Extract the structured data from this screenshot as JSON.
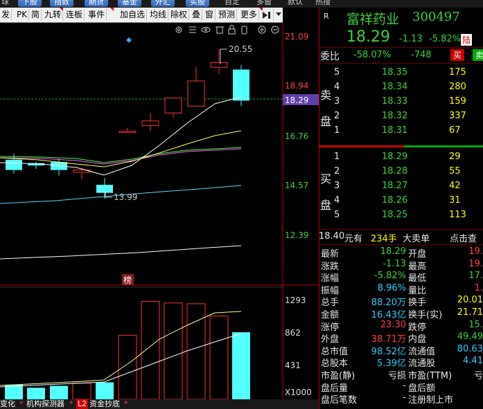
{
  "top_strip": {
    "tabs": [
      "下股",
      "指数",
      "期货",
      "基金",
      "外汇",
      "买股"
    ],
    "plain": [
      "球",
      "自定",
      "多窗",
      "默认",
      "热搜"
    ]
  },
  "toolbar": {
    "buttons": [
      "发",
      "PK",
      "简",
      "九转",
      "连板",
      "事件",
      "加自选",
      "均线",
      "除权",
      "叠",
      "窗",
      "预测",
      "更多"
    ],
    "more_icon": "play-bar-icon",
    "dropdown_icon": "chevron-down-icon"
  },
  "chart_icons": [
    "gear-icon",
    "tune-icon",
    "eye-icon",
    "trash-icon",
    "lock-icon",
    "hand-icon",
    "zoom-in-icon",
    "zoom-out-icon"
  ],
  "price_axis": {
    "ticks": [
      "21.09",
      "18.94",
      "18.29",
      "16.76",
      "14.57",
      "12.39"
    ],
    "current": "18.29",
    "high_label": "20.55",
    "low_label": "13.99",
    "badge": "榜"
  },
  "volume_axis": {
    "ticks": [
      "1293",
      "862",
      "431",
      "X1000"
    ]
  },
  "chart_data": {
    "type": "candlestick",
    "candles": [
      {
        "open": 15.7,
        "high": 15.95,
        "low": 15.1,
        "close": 15.25
      },
      {
        "open": 15.55,
        "high": 15.6,
        "low": 15.3,
        "close": 15.45
      },
      {
        "open": 15.6,
        "high": 15.75,
        "low": 15.0,
        "close": 15.25
      },
      {
        "open": 15.15,
        "high": 15.35,
        "low": 14.85,
        "close": 15.25
      },
      {
        "open": 14.6,
        "high": 14.9,
        "low": 13.99,
        "close": 14.25
      },
      {
        "open": 16.95,
        "high": 17.1,
        "low": 16.95,
        "close": 16.95
      },
      {
        "open": 17.2,
        "high": 17.75,
        "low": 16.95,
        "close": 17.4
      },
      {
        "open": 17.75,
        "high": 18.45,
        "low": 17.55,
        "close": 18.4
      },
      {
        "open": 18.05,
        "high": 19.75,
        "low": 18.05,
        "close": 19.15
      },
      {
        "open": 19.75,
        "high": 20.55,
        "low": 19.45,
        "close": 19.95
      },
      {
        "open": 19.65,
        "high": 19.85,
        "low": 18.05,
        "close": 18.29
      }
    ],
    "volumes": [
      190,
      150,
      175,
      210,
      220,
      830,
      1270,
      1250,
      1240,
      1080,
      870
    ],
    "ylim_price": [
      12.39,
      21.09
    ],
    "ylim_volume": [
      0,
      1293
    ]
  },
  "stock": {
    "badge": "R",
    "name": "富祥药业",
    "code": "300497",
    "price": "18.29",
    "change": "-1.13",
    "pct": "-5.82%",
    "market_tag": "陆"
  },
  "weibi": {
    "label": "委比",
    "pct": "-58.07%",
    "diff": "-748",
    "buy_btn": "买",
    "sell_btn": "卖"
  },
  "order_book": {
    "sell_label": [
      "卖",
      "盘"
    ],
    "buy_label": [
      "买",
      "盘"
    ],
    "sells": [
      {
        "level": "5",
        "price": "18.35",
        "vol": "175"
      },
      {
        "level": "4",
        "price": "18.34",
        "vol": "280"
      },
      {
        "level": "3",
        "price": "18.33",
        "vol": "159"
      },
      {
        "level": "2",
        "price": "18.32",
        "vol": "337"
      },
      {
        "level": "1",
        "price": "18.31",
        "vol": "67"
      }
    ],
    "buys": [
      {
        "level": "1",
        "price": "18.29",
        "vol": "29"
      },
      {
        "level": "2",
        "price": "18.28",
        "vol": "55"
      },
      {
        "level": "3",
        "price": "18.27",
        "vol": "42"
      },
      {
        "level": "4",
        "price": "18.26",
        "vol": "31"
      },
      {
        "level": "5",
        "price": "18.25",
        "vol": "113"
      }
    ]
  },
  "big_order": {
    "price": "18.40",
    "unit": "元有",
    "qty": "234手",
    "label": "大卖单",
    "link": "点击查"
  },
  "quotes": [
    {
      "l1": "最新",
      "v1": "18.29",
      "c1": "green",
      "l2": "开盘",
      "v2": "19.",
      "c2": "red"
    },
    {
      "l1": "涨跌",
      "v1": "-1.13",
      "c1": "green",
      "l2": "最高",
      "v2": "19.",
      "c2": "red"
    },
    {
      "l1": "涨幅",
      "v1": "-5.82%",
      "c1": "green",
      "l2": "最低",
      "v2": "17.",
      "c2": "green"
    },
    {
      "l1": "振幅",
      "v1": "8.96%",
      "c1": "cyan",
      "l2": "量比",
      "v2": "1.",
      "c2": "red"
    },
    {
      "l1": "总手",
      "v1": "88.20万",
      "c1": "cyan",
      "l2": "换手",
      "v2": "20.01",
      "c2": "yellow"
    },
    {
      "l1": "金额",
      "v1": "16.43亿",
      "c1": "cyan",
      "l2": "换手(实)",
      "v2": "21.71",
      "c2": "yellow"
    },
    {
      "l1": "涨停",
      "v1": "23.30",
      "c1": "red",
      "l2": "跌停",
      "v2": "15.",
      "c2": "green"
    },
    {
      "l1": "外盘",
      "v1": "38.71万",
      "c1": "red",
      "l2": "内盘",
      "v2": "49.49",
      "c2": "green"
    },
    {
      "l1": "总市值",
      "v1": "98.52亿",
      "c1": "cyan",
      "l2": "流通值",
      "v2": "80.63",
      "c2": "cyan"
    },
    {
      "l1": "总股本",
      "v1": "5.39亿",
      "c1": "cyan",
      "l2": "流通股",
      "v2": "4.41",
      "c2": "cyan"
    },
    {
      "l1": "市盈(静)",
      "v1": "亏损",
      "c1": "white",
      "l2": "市盈(TTM)",
      "v2": "亏",
      "c2": "white"
    },
    {
      "l1": "盘后量",
      "v1": "-",
      "c1": "white",
      "l2": "盘后额",
      "v2": "",
      "c2": "white"
    },
    {
      "l1": "盘后笔数",
      "v1": "-",
      "c1": "white",
      "l2": "注册制上市",
      "v2": "",
      "c2": "white"
    }
  ],
  "bottom_tabs": [
    "变化",
    "机构探测器",
    "资金抄底"
  ],
  "bottom_badge": "L2",
  "colors": {
    "up": "#ff3232",
    "down": "#54ffff",
    "ma5": "#ffffff",
    "ma10": "#ffff66",
    "ma20": "#ff66ff",
    "ma30": "#44ff44",
    "ma60": "#5fd7ff"
  }
}
